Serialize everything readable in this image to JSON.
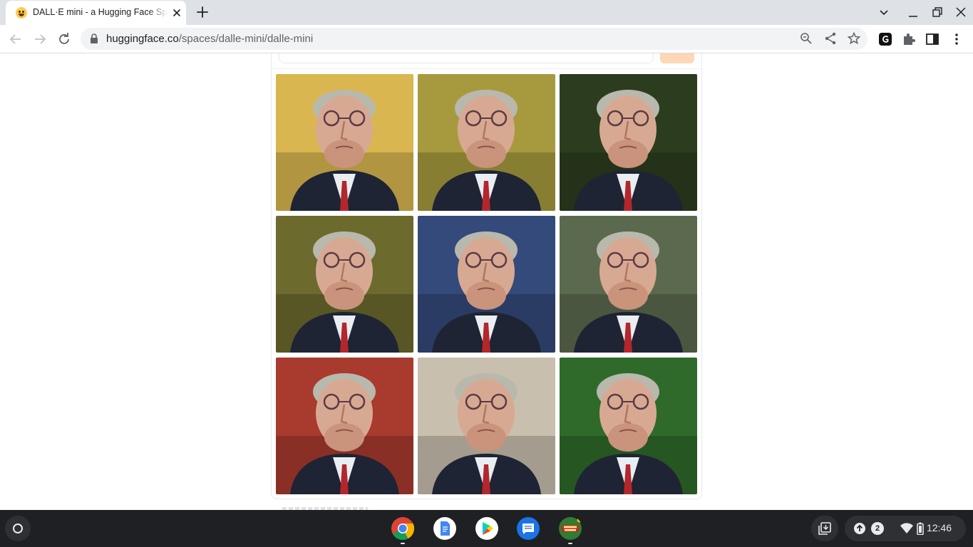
{
  "browser": {
    "tab": {
      "title": "DALL·E mini - a Hugging Face Space by dalle-mini",
      "favicon": "hugging-face-emoji"
    },
    "address": {
      "host": "huggingface.co",
      "path": "/spaces/dalle-mini/dalle-mini"
    }
  },
  "page": {
    "gallery": {
      "rows": 3,
      "columns": 3,
      "images": [
        {
          "background": "#d9b64f"
        },
        {
          "background": "#a79a3e"
        },
        {
          "background": "#2b3d1e"
        },
        {
          "background": "#6c6a2d"
        },
        {
          "background": "#344a7a"
        },
        {
          "background": "#5b6a4e"
        },
        {
          "background": "#a93a2e"
        },
        {
          "background": "#c9bfae"
        },
        {
          "background": "#2f6a2a"
        }
      ]
    }
  },
  "shelf": {
    "apps": [
      "chrome-icon",
      "google-docs-icon",
      "google-play-icon",
      "messages-icon",
      "word-collect-icon"
    ],
    "tray": {
      "notification_count": "2",
      "time": "12:46"
    }
  },
  "colors": {
    "run_button": "#fdd7b6",
    "shelf": "#1f2023",
    "tabstrip": "#dee1e6"
  }
}
